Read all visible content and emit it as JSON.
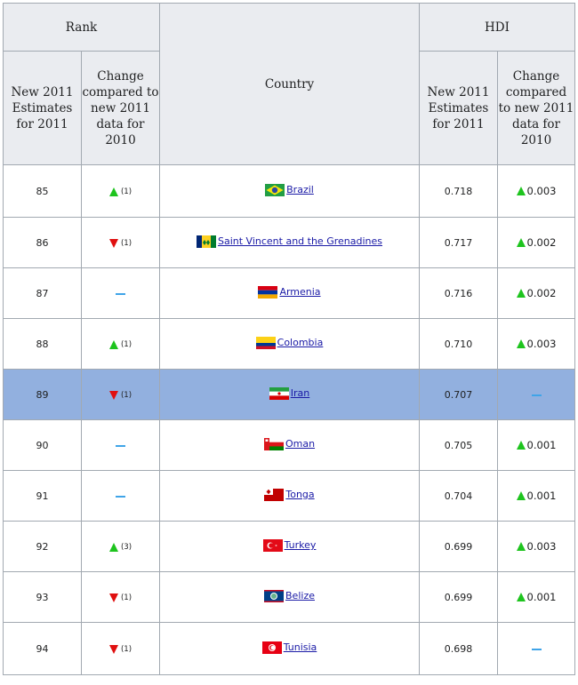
{
  "header": {
    "rank": "Rank",
    "country": "Country",
    "hdi": "HDI",
    "rank_estimates": "New 2011 Estimates for 2011",
    "rank_change": "Change compared to new 2011 data for 2010",
    "hdi_estimates": "New 2011 Estimates for 2011",
    "hdi_change": "Change compared to new 2011 data for 2010"
  },
  "colors": {
    "up": "#1ec41e",
    "down": "#e01010",
    "no_change": "#3fa4e8",
    "highlight_row": "#92b0df",
    "header_bg": "#eaecf0",
    "link": "#1a1aa6"
  },
  "rows": [
    {
      "rank": "85",
      "rank_dir": "up",
      "rank_change": "(1)",
      "country": "Brazil",
      "flag": "brazil-flag-icon",
      "hdi": "0.718",
      "hdi_dir": "up",
      "hdi_change": "0.003"
    },
    {
      "rank": "86",
      "rank_dir": "down",
      "rank_change": "(1)",
      "country": "Saint Vincent and the Grenadines",
      "flag": "saint-vincent-flag-icon",
      "hdi": "0.717",
      "hdi_dir": "up",
      "hdi_change": "0.002"
    },
    {
      "rank": "87",
      "rank_dir": "none",
      "rank_change": "",
      "country": "Armenia",
      "flag": "armenia-flag-icon",
      "hdi": "0.716",
      "hdi_dir": "up",
      "hdi_change": "0.002"
    },
    {
      "rank": "88",
      "rank_dir": "up",
      "rank_change": "(1)",
      "country": "Colombia",
      "flag": "colombia-flag-icon",
      "hdi": "0.710",
      "hdi_dir": "up",
      "hdi_change": "0.003"
    },
    {
      "rank": "89",
      "rank_dir": "down",
      "rank_change": "(1)",
      "country": "Iran",
      "flag": "iran-flag-icon",
      "hdi": "0.707",
      "hdi_dir": "none",
      "hdi_change": "",
      "highlight": true
    },
    {
      "rank": "90",
      "rank_dir": "none",
      "rank_change": "",
      "country": "Oman",
      "flag": "oman-flag-icon",
      "hdi": "0.705",
      "hdi_dir": "up",
      "hdi_change": "0.001"
    },
    {
      "rank": "91",
      "rank_dir": "none",
      "rank_change": "",
      "country": "Tonga",
      "flag": "tonga-flag-icon",
      "hdi": "0.704",
      "hdi_dir": "up",
      "hdi_change": "0.001"
    },
    {
      "rank": "92",
      "rank_dir": "up",
      "rank_change": "(3)",
      "country": "Turkey",
      "flag": "turkey-flag-icon",
      "hdi": "0.699",
      "hdi_dir": "up",
      "hdi_change": "0.003"
    },
    {
      "rank": "93",
      "rank_dir": "down",
      "rank_change": "(1)",
      "country": "Belize",
      "flag": "belize-flag-icon",
      "hdi": "0.699",
      "hdi_dir": "up",
      "hdi_change": "0.001"
    },
    {
      "rank": "94",
      "rank_dir": "down",
      "rank_change": "(1)",
      "country": "Tunisia",
      "flag": "tunisia-flag-icon",
      "hdi": "0.698",
      "hdi_dir": "none",
      "hdi_change": ""
    }
  ]
}
